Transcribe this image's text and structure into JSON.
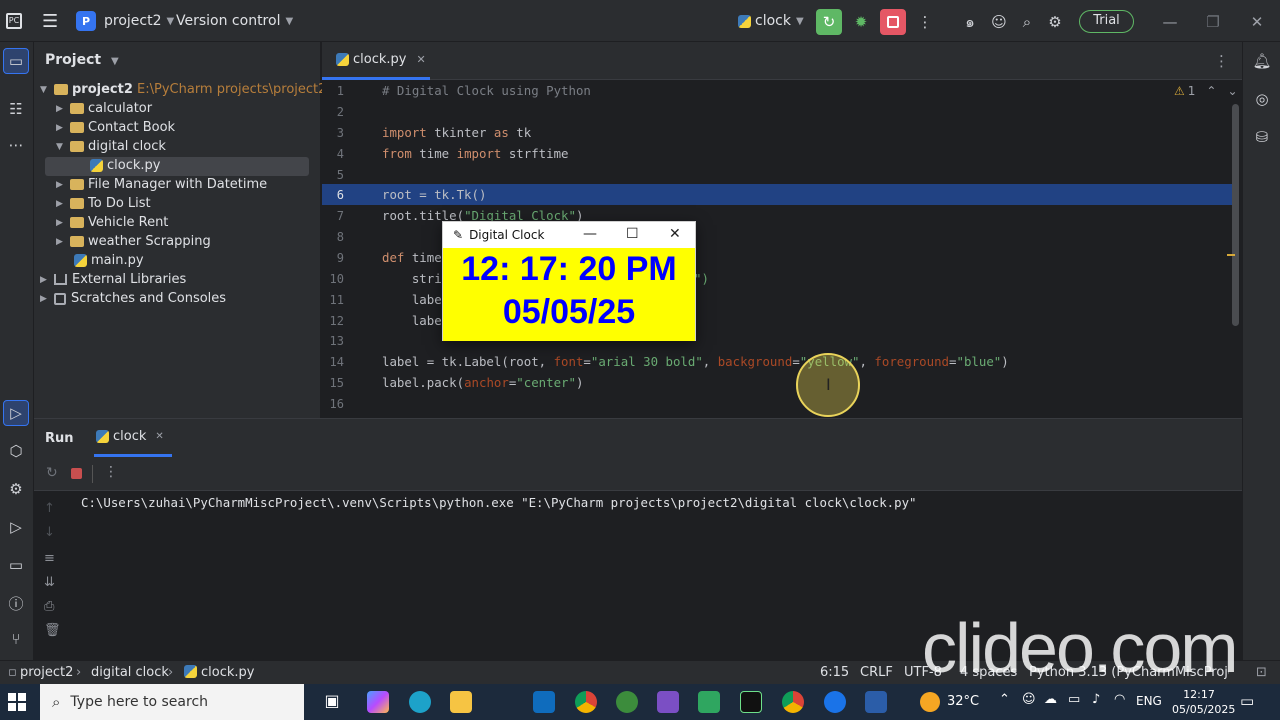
{
  "titlebar": {
    "project_badge": "P",
    "project_name": "project2",
    "vcs": "Version control",
    "run_config": "clock",
    "trial": "Trial"
  },
  "project_panel": {
    "title": "Project",
    "tree": [
      {
        "label": "project2",
        "path": "E:\\PyCharm projects\\project2",
        "type": "root"
      },
      {
        "label": "calculator",
        "type": "folder"
      },
      {
        "label": "Contact Book",
        "type": "folder"
      },
      {
        "label": "digital clock",
        "type": "folder-open"
      },
      {
        "label": "clock.py",
        "type": "py-selected"
      },
      {
        "label": "File Manager with Datetime",
        "type": "folder"
      },
      {
        "label": "To Do List",
        "type": "folder"
      },
      {
        "label": "Vehicle Rent",
        "type": "folder"
      },
      {
        "label": "weather  Scrapping",
        "type": "folder"
      },
      {
        "label": "main.py",
        "type": "py"
      },
      {
        "label": "External Libraries",
        "type": "lib"
      },
      {
        "label": "Scratches and Consoles",
        "type": "scratch"
      }
    ]
  },
  "editor": {
    "tab": "clock.py",
    "warning_count": "1",
    "line_numbers": [
      "1",
      "2",
      "3",
      "4",
      "5",
      "6",
      "7",
      "8",
      "9",
      "10",
      "11",
      "12",
      "13",
      "14",
      "15",
      "16"
    ],
    "lines": {
      "l1": "# Digital Clock using Python",
      "l3a": "import",
      "l3b": " tkinter ",
      "l3c": "as",
      "l3d": " tk",
      "l4a": "from",
      "l4b": " time ",
      "l4c": "import",
      "l4d": " strftime",
      "l6": "root = tk.Tk()",
      "l7a": "root.title(",
      "l7b": "\"Digital Clock\"",
      "l7c": ")",
      "l9a": "def",
      "l9b": " time",
      "l10a": "    stri",
      "l10b": "\")",
      "l11": "    labe",
      "l12": "    labe",
      "l14a": "label = tk.Label(root, ",
      "l14b": "font",
      "l14c": "=",
      "l14d": "\"arial 30 bold\"",
      "l14e": ", ",
      "l14f": "background",
      "l14g": "=",
      "l14h": "\"yellow\"",
      "l14i": ", ",
      "l14j": "foreground",
      "l14k": "=",
      "l14l": "\"blue\"",
      "l14m": ")",
      "l15a": "label.pack(",
      "l15b": "anchor",
      "l15c": "=",
      "l15d": "\"center\"",
      "l15e": ")"
    }
  },
  "clock_window": {
    "title": "Digital Clock",
    "time": "12: 17: 20 PM",
    "date": "05/05/25"
  },
  "run_panel": {
    "title": "Run",
    "tab": "clock",
    "output": "C:\\Users\\zuhai\\PyCharmMiscProject\\.venv\\Scripts\\python.exe \"E:\\PyCharm projects\\project2\\digital clock\\clock.py\""
  },
  "statusbar": {
    "crumbs": [
      "project2",
      "digital clock",
      "clock.py"
    ],
    "position": "6:15",
    "line_sep": "CRLF",
    "encoding": "UTF-8",
    "indent": "4 spaces",
    "interpreter": "Python 3.13 (PyCharmMiscProject)"
  },
  "watermark": "clideo.com",
  "taskbar": {
    "search_placeholder": "Type here to search",
    "temperature": "32°C",
    "language": "ENG",
    "time": "12:17",
    "date": "05/05/2025"
  },
  "colors": {
    "accent": "#3574f0",
    "run_green": "#5fb865",
    "stop_red": "#e55765",
    "clock_bg": "#ffff00",
    "clock_fg": "#0000ff"
  }
}
